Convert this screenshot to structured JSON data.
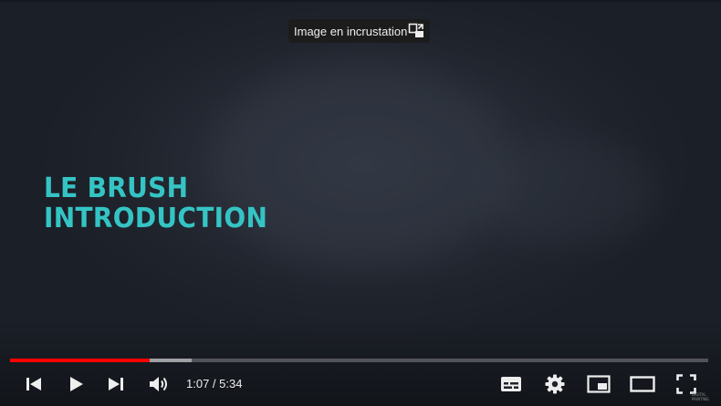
{
  "video": {
    "title_line1": "LE BRUSH",
    "title_line2": "INTRODUCTION",
    "title_color": "#35c4c4",
    "background_color": "#262b35"
  },
  "tooltip": {
    "label": "Image en incrustation",
    "icon": "exit-pip-icon"
  },
  "progress": {
    "played_fraction": 0.2,
    "buffered_fraction": 0.26,
    "played_color": "#ff0000"
  },
  "controls": {
    "time_display": "1:07 / 5:34",
    "left_icons": [
      "previous-icon",
      "play-icon",
      "next-icon",
      "volume-icon"
    ],
    "right_icons": [
      "subtitles-icon",
      "settings-icon",
      "miniplayer-icon",
      "theater-mode-icon",
      "fullscreen-icon"
    ]
  },
  "watermark": {
    "line1": "DIGITAL",
    "line2": "PAINTING"
  }
}
